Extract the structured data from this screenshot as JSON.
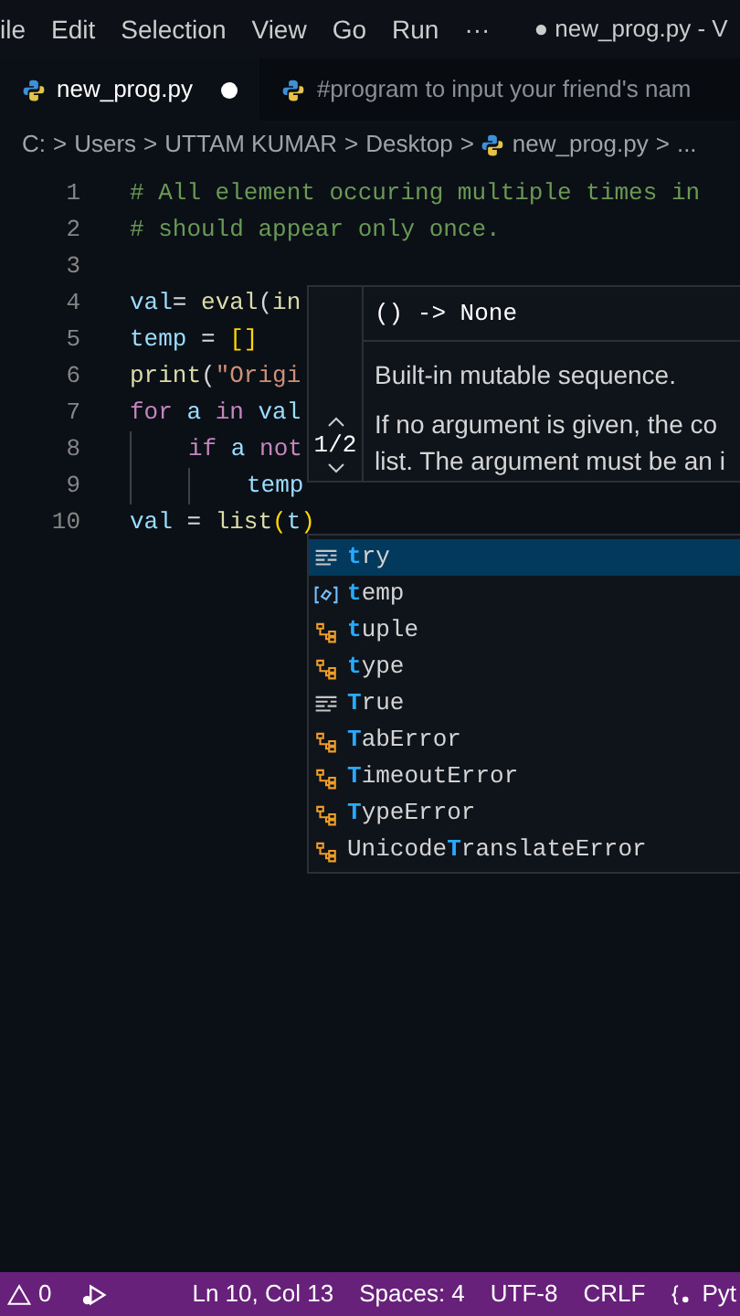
{
  "menu_bar": {
    "items": [
      "ile",
      "Edit",
      "Selection",
      "View",
      "Go",
      "Run",
      "···"
    ],
    "title": "● new_prog.py - V"
  },
  "tabs": [
    {
      "label": "new_prog.py",
      "selected": true,
      "modified": true
    },
    {
      "label": "#program to input your friend's nam",
      "selected": false,
      "modified": false
    }
  ],
  "breadcrumb": [
    {
      "label": "C:"
    },
    {
      "separator": ">",
      "label": "Users"
    },
    {
      "separator": ">",
      "label": "UTTAM KUMAR"
    },
    {
      "separator": ">",
      "label": "Desktop"
    },
    {
      "separator": ">",
      "label": "new_prog.py",
      "kind": "file"
    },
    {
      "separator": ">",
      "label": "..."
    }
  ],
  "code_lines": [
    {
      "number": "1",
      "tokens": [
        {
          "text": "# All element occuring multiple times in",
          "kind": "comment"
        }
      ]
    },
    {
      "number": "2",
      "tokens": [
        {
          "text": "# should appear only once.",
          "kind": "comment"
        }
      ]
    },
    {
      "number": "3"
    },
    {
      "number": "4",
      "tokens": [
        {
          "text": "val",
          "kind": "var"
        },
        {
          "text": "= ",
          "kind": "op"
        },
        {
          "text": "eval",
          "kind": "func"
        },
        {
          "text": "(",
          "kind": "op"
        },
        {
          "text": "in",
          "kind": "func"
        }
      ]
    },
    {
      "number": "5",
      "tokens": [
        {
          "text": "temp",
          "kind": "var"
        },
        {
          "text": " = ",
          "kind": "op"
        },
        {
          "text": "[]",
          "kind": "bracket"
        }
      ]
    },
    {
      "number": "6",
      "tokens": [
        {
          "text": "print",
          "kind": "func"
        },
        {
          "text": "(",
          "kind": "op"
        },
        {
          "text": "\"Origi",
          "kind": "string"
        }
      ]
    },
    {
      "number": "7",
      "tokens": [
        {
          "text": "for ",
          "kind": "keyword"
        },
        {
          "text": "a ",
          "kind": "var"
        },
        {
          "text": "in ",
          "kind": "keyword"
        },
        {
          "text": "val",
          "kind": "var"
        }
      ],
      "children": [
        {
          "number": "8",
          "tokens": [
            {
              "text": "if ",
              "kind": "keyword"
            },
            {
              "text": "a ",
              "kind": "var"
            },
            {
              "text": "not",
              "kind": "keyword"
            }
          ],
          "children": [
            {
              "number": "9",
              "tokens": [
                {
                  "text": "temp",
                  "kind": "var"
                }
              ]
            }
          ]
        }
      ]
    },
    {
      "number": "10",
      "tokens": [
        {
          "text": "val",
          "kind": "var"
        },
        {
          "text": " = ",
          "kind": "op"
        },
        {
          "text": "list",
          "kind": "func"
        },
        {
          "text": "(",
          "kind": "bracket"
        },
        {
          "text": "t",
          "kind": "var"
        },
        {
          "text": ")",
          "kind": "bracket"
        }
      ]
    }
  ],
  "hover": {
    "signature": "() -> None",
    "counter": "1/2",
    "summary": "Built-in mutable sequence.",
    "details": [
      "If no argument is given, the co",
      "list. The argument must be an i"
    ]
  },
  "suggestions": [
    {
      "kind": "keyword",
      "match": "t",
      "after": "ry",
      "selected": true
    },
    {
      "kind": "variable",
      "match": "t",
      "after": "emp",
      "selected": false
    },
    {
      "kind": "class",
      "match": "t",
      "after": "uple",
      "selected": false
    },
    {
      "kind": "class",
      "match": "t",
      "after": "ype",
      "selected": false
    },
    {
      "kind": "keyword",
      "match": "T",
      "after": "rue",
      "selected": false
    },
    {
      "kind": "class",
      "match": "T",
      "after": "abError",
      "selected": false
    },
    {
      "kind": "class",
      "match": "T",
      "after": "imeoutError",
      "selected": false
    },
    {
      "kind": "class",
      "match": "T",
      "after": "ypeError",
      "selected": false
    },
    {
      "kind": "class",
      "before": "Unicode",
      "match": "T",
      "after": "ranslateError",
      "selected": false
    }
  ],
  "status_bar": {
    "warnings": "0",
    "items": [
      "Ln 10, Col 13",
      "Spaces: 4",
      "UTF-8",
      "CRLF"
    ],
    "language": "Pyt"
  }
}
